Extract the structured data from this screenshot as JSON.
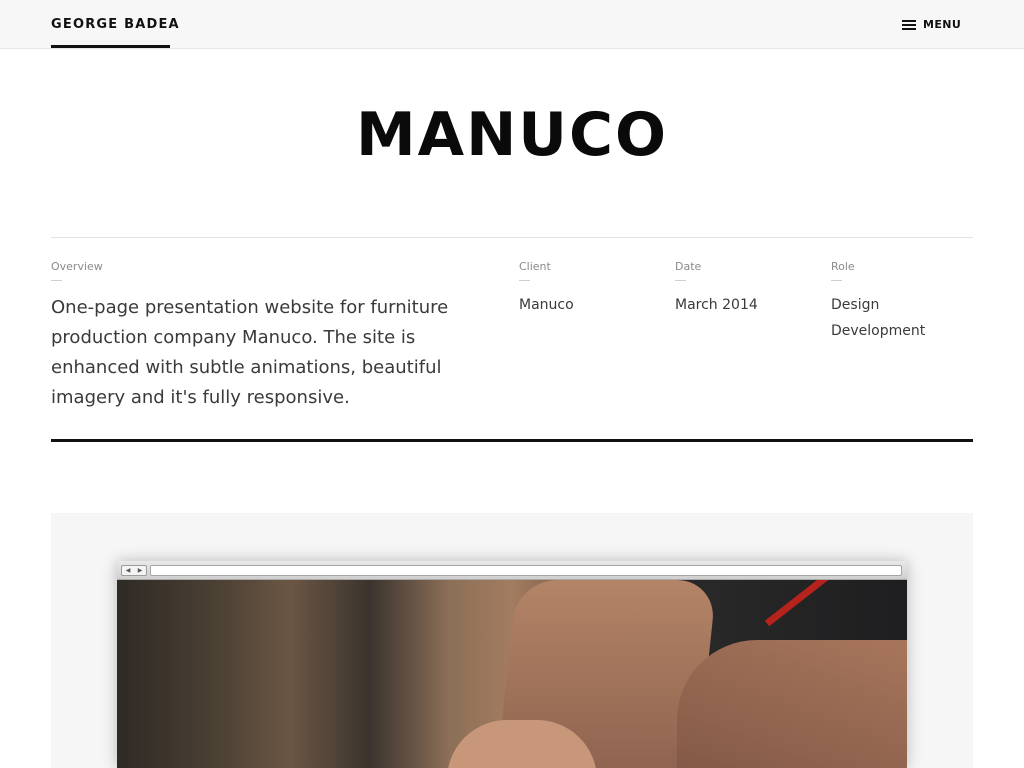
{
  "header": {
    "brand": "GEORGE BADEA",
    "menu_label": "MENU"
  },
  "page": {
    "title": "MANUCO"
  },
  "overview": {
    "label": "Overview",
    "text": "One-page presentation website for furniture production company Manuco. The site is enhanced with subtle animations, beautiful imagery and it's fully responsive."
  },
  "client": {
    "label": "Client",
    "value": "Manuco"
  },
  "date": {
    "label": "Date",
    "value": "March 2014"
  },
  "role": {
    "label": "Role",
    "values": [
      "Design",
      "Development"
    ]
  },
  "colors": {
    "accent": "#111111",
    "header_bg": "#f7f7f7",
    "showcase_bg": "#f6f6f6"
  },
  "icons": {
    "menu": "hamburger-icon",
    "back": "browser-back-icon",
    "forward": "browser-forward-icon"
  }
}
